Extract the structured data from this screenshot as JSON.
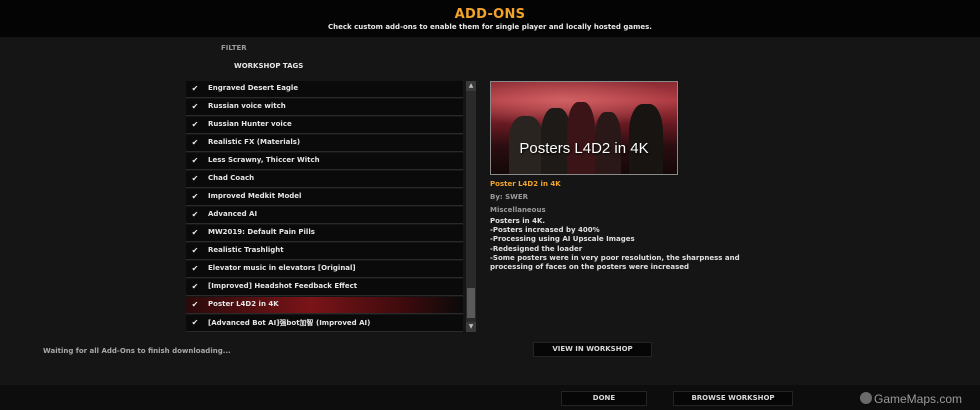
{
  "header": {
    "title": "ADD-ONS",
    "subtitle": "Check custom add-ons to enable them for single player and locally hosted games."
  },
  "filter": {
    "label": "FILTER",
    "workshop_tags_label": "WORKSHOP TAGS"
  },
  "addons": [
    {
      "name": "Engraved Desert Eagle",
      "checked": true
    },
    {
      "name": "Russian voice witch",
      "checked": true
    },
    {
      "name": "Russian Hunter voice",
      "checked": true
    },
    {
      "name": "Realistic FX (Materials)",
      "checked": true
    },
    {
      "name": "Less Scrawny, Thiccer Witch",
      "checked": true
    },
    {
      "name": "Chad Coach",
      "checked": true
    },
    {
      "name": "Improved Medkit Model",
      "checked": true
    },
    {
      "name": "Advanced AI",
      "checked": true
    },
    {
      "name": "MW2019: Default Pain Pills",
      "checked": true
    },
    {
      "name": "Realistic Trashlight",
      "checked": true
    },
    {
      "name": "Elevator music in elevators [Original]",
      "checked": true
    },
    {
      "name": "[Improved] Headshot Feedback Effect",
      "checked": true
    },
    {
      "name": "Poster L4D2 in 4K",
      "checked": true,
      "selected": true
    },
    {
      "name": "[Advanced Bot AI]强bot加智 (Improved AI)",
      "checked": true
    }
  ],
  "check_glyph": "✔",
  "scrollbar": {
    "up_glyph": "▲",
    "down_glyph": "▼"
  },
  "details": {
    "preview_caption": "Posters L4D2 in 4K",
    "title": "Poster L4D2 in 4K",
    "author": "By: SWER",
    "category": "Miscellaneous",
    "description": [
      "Posters in 4K.",
      "-Posters increased by 400%",
      "-Processing using AI Upscale Images",
      "-Redesigned the loader",
      "-Some posters were in very poor resolution, the sharpness and processing of faces on the posters were increased"
    ]
  },
  "status": "Waiting for all Add-Ons to finish downloading...",
  "buttons": {
    "view_in_workshop": "VIEW IN WORKSHOP",
    "done": "DONE",
    "browse_workshop": "BROWSE WORKSHOP"
  },
  "watermark": "GameMaps.com",
  "colors": {
    "accent": "#f2a32a",
    "selected_row": "#7a1418",
    "background": "#151515"
  }
}
